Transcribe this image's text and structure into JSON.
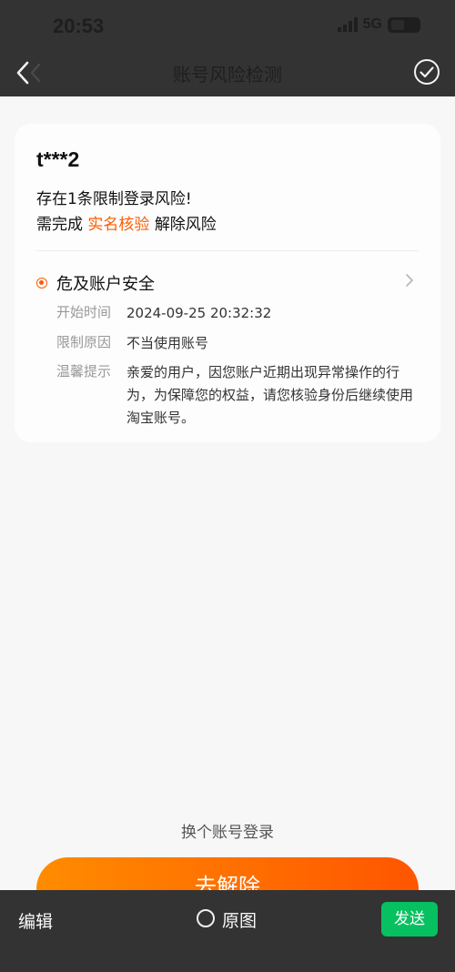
{
  "status_bar": {
    "time": "20:53",
    "network": "5G"
  },
  "header": {
    "title": "账号风险检测"
  },
  "card": {
    "username": "t***2",
    "risk_summary": "存在1条限制登录风险!",
    "action_prefix": "需完成",
    "action_link": "实名核验",
    "action_suffix": "解除风险",
    "risk_item": {
      "title": "危及账户安全",
      "start_time_label": "开始时间",
      "start_time_value": "2024-09-25 20:32:32",
      "reason_label": "限制原因",
      "reason_value": "不当使用账号",
      "tip_label": "温馨提示",
      "tip_value": "亲爱的用户，因您账户近期出现异常操作的行为，为保障您的权益，请您核验身份后继续使用淘宝账号。"
    }
  },
  "switch_account": "换个账号登录",
  "unlock_button": "去解除",
  "bottom_bar": {
    "edit": "编辑",
    "original": "原图",
    "send": "发送"
  },
  "colors": {
    "accent": "#ff5a00",
    "send_green": "#07c160",
    "overlay": "#333333"
  },
  "icons": [
    "back-icon",
    "check-circle-icon",
    "chevron-right-icon",
    "radio-icon",
    "signal-icon",
    "battery-icon"
  ]
}
